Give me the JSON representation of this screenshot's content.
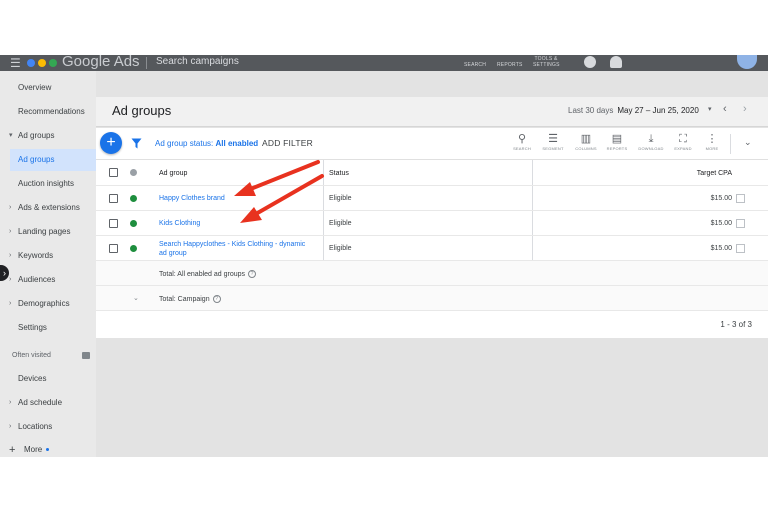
{
  "topbar": {
    "menu_glyph": "☰",
    "app_name": "Google Ads",
    "campaign_name": "Search campaigns",
    "tools": [
      {
        "label": "SEARCH"
      },
      {
        "label": "REPORTS"
      },
      {
        "label": "TOOLS & SETTINGS"
      }
    ],
    "logo_colors": [
      "#4285f4",
      "#fbbc04",
      "#34a853"
    ]
  },
  "sidebar": {
    "items": [
      {
        "label": "Overview"
      },
      {
        "label": "Recommendations"
      },
      {
        "label": "Ad groups",
        "caret": "▾"
      },
      {
        "label": "Ad groups",
        "active": true
      },
      {
        "label": "Auction insights"
      },
      {
        "label": "Ads & extensions",
        "caret": "›"
      },
      {
        "label": "Landing pages",
        "caret": "›"
      },
      {
        "label": "Keywords",
        "caret": "›"
      },
      {
        "label": "Audiences",
        "caret": "›"
      },
      {
        "label": "Demographics",
        "caret": "›"
      },
      {
        "label": "Settings"
      },
      {
        "label": "Often visited"
      },
      {
        "label": "Devices"
      },
      {
        "label": "Ad schedule",
        "caret": "›"
      },
      {
        "label": "Locations",
        "caret": "›"
      },
      {
        "label": "More"
      }
    ],
    "expander_glyph": "›"
  },
  "header": {
    "title": "Ad groups",
    "date_label": "Last 30 days",
    "date_value": "May 27 – Jun 25, 2020",
    "dropdown_glyph": "▾",
    "prev_glyph": "‹",
    "next_glyph": "›"
  },
  "toolbar": {
    "add_glyph": "+",
    "filter_label": "Ad group status:",
    "filter_value": "All enabled",
    "add_filter": "ADD FILTER",
    "tools": [
      {
        "label": "SEARCH",
        "glyph": "⚲"
      },
      {
        "label": "SEGMENT",
        "glyph": "☰"
      },
      {
        "label": "COLUMNS",
        "glyph": "▥"
      },
      {
        "label": "REPORTS",
        "glyph": "▤"
      },
      {
        "label": "DOWNLOAD",
        "glyph": "⤓"
      },
      {
        "label": "EXPAND",
        "glyph": "⛶"
      },
      {
        "label": "MORE",
        "glyph": "⋮"
      }
    ],
    "collapse_glyph": "⌄"
  },
  "table": {
    "columns": {
      "ad_group": "Ad group",
      "status": "Status",
      "target_cpa": "Target CPA"
    },
    "rows": [
      {
        "name": "Happy Clothes brand",
        "status": "Eligible",
        "cpa": "$15.00"
      },
      {
        "name": "Kids Clothing",
        "status": "Eligible",
        "cpa": "$15.00"
      },
      {
        "name": "Search Happyclothes - Kids Clothing - dynamic ad group",
        "status": "Eligible",
        "cpa": "$15.00"
      }
    ],
    "total_enabled": "Total: All enabled ad groups",
    "total_campaign": "Total: Campaign",
    "info_glyph": "?",
    "chevron_glyph": "⌄",
    "pager": "1 - 3 of 3"
  },
  "colors": {
    "accent": "#1a73e8",
    "enabled_dot": "#1e8e3e",
    "annotation_arrow": "#e8321f"
  }
}
